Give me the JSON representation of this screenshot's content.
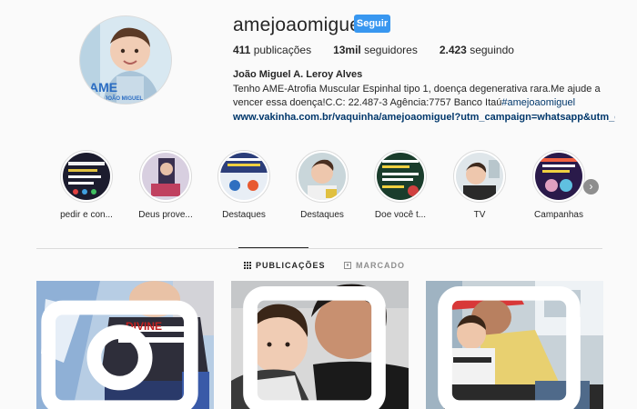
{
  "profile": {
    "username": "amejoaomiguel",
    "follow_label": "Seguir",
    "stats": {
      "posts_value": "411",
      "posts_label": "publicações",
      "followers_value": "13mil",
      "followers_label": "seguidores",
      "following_value": "2.423",
      "following_label": "seguindo"
    },
    "full_name": "João Miguel A. Leroy Alves",
    "bio_text": "Tenho AME-Atrofia Muscular Espinhal tipo 1, doença degenerativa rara.Me ajude a vencer essa doença!C.C: 22.487-3 Agência:7757 Banco Itaú",
    "bio_hashtag": "#amejoaomiguel",
    "website": "www.vakinha.com.br/vaquinha/amejoaomiguel?utm_campaign=whatsapp&utm_c...",
    "avatar_logo_text": "AME",
    "avatar_logo_sub": "JOÃO MIGUEL"
  },
  "highlights": [
    {
      "label": "pedir e con...",
      "color": "#1c1c2e"
    },
    {
      "label": "Deus prove...",
      "color": "#c8b6c9"
    },
    {
      "label": "Destaques",
      "color": "#2c3e7a"
    },
    {
      "label": "Destaques",
      "color": "#a9c2c8"
    },
    {
      "label": "Doe você t...",
      "color": "#1a3d2c"
    },
    {
      "label": "TV",
      "color": "#8aa0a8"
    },
    {
      "label": "Campanhas",
      "color": "#2a1a4a"
    }
  ],
  "tabs": {
    "posts_label": "PUBLICAÇÕES",
    "tagged_label": "MARCADO"
  },
  "colors": {
    "accent": "#3897f0",
    "link": "#00376b",
    "border": "#dbdbdb",
    "muted": "#8e8e8e"
  }
}
